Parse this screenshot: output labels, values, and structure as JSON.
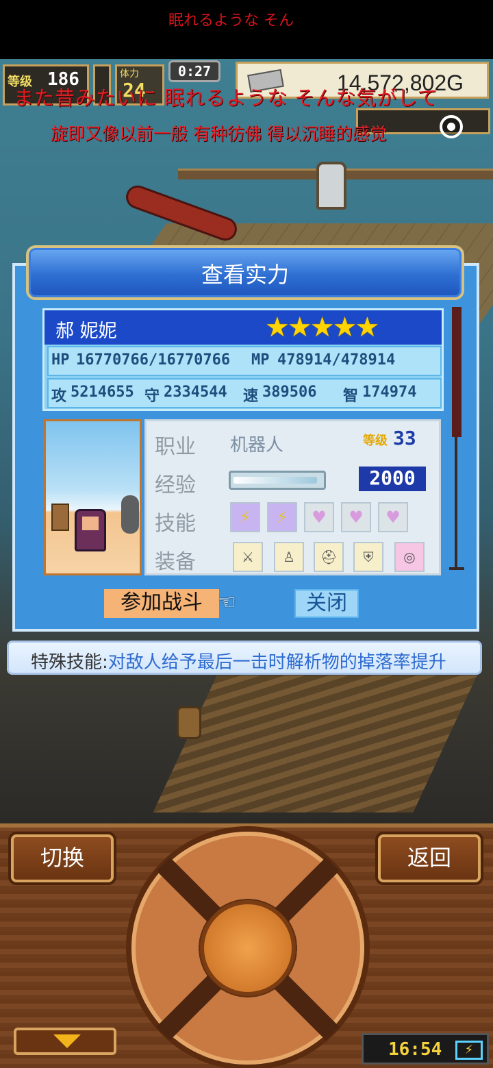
{
  "ticker": {
    "text": "眠れるような そん"
  },
  "hud": {
    "level_label": "等级",
    "level_value": "186",
    "day_label": "体力",
    "day_value": "24",
    "time": "0:27",
    "money": "14,572,802G"
  },
  "subtitles": {
    "jp": "また昔みたいに 眠れるような そんな気がして",
    "cn": "旋即又像以前一般 有种彷佛 得以沉睡的感觉"
  },
  "dialog": {
    "title": "查看实力",
    "name": "郝 妮妮",
    "stars": "★★★★★",
    "row1": {
      "hp_label": "HP",
      "hp": "16770766/16770766",
      "mp_label": "MP",
      "mp": "478914/478914"
    },
    "row2": {
      "atk_label": "攻",
      "atk": "5214655",
      "def_label": "守",
      "def": "2334544",
      "spd_label": "速",
      "spd": "389506",
      "int_label": "智",
      "int": "174974"
    },
    "labels": {
      "job": "职业",
      "exp": "经验",
      "skill": "技能",
      "equip": "装备"
    },
    "job": "机器人",
    "level_label": "等级",
    "level": "33",
    "exp_value": "2000",
    "exp_fill": 0.95,
    "skills": [
      "bolt-icon",
      "bolt-icon",
      "heart-icon",
      "heart-icon",
      "heart-icon"
    ],
    "equipment": [
      "sword-icon",
      "armor-icon",
      "helmet-icon",
      "shield-icon",
      "ring-icon"
    ],
    "join_button": "参加战斗",
    "close_button": "关闭"
  },
  "special_skill": {
    "label": "特殊技能:",
    "text": "对敌人给予最后一击时解析物的掉落率提升"
  },
  "controls": {
    "switch_label": "切换",
    "back_label": "返回"
  },
  "clock": {
    "time": "16:54"
  }
}
